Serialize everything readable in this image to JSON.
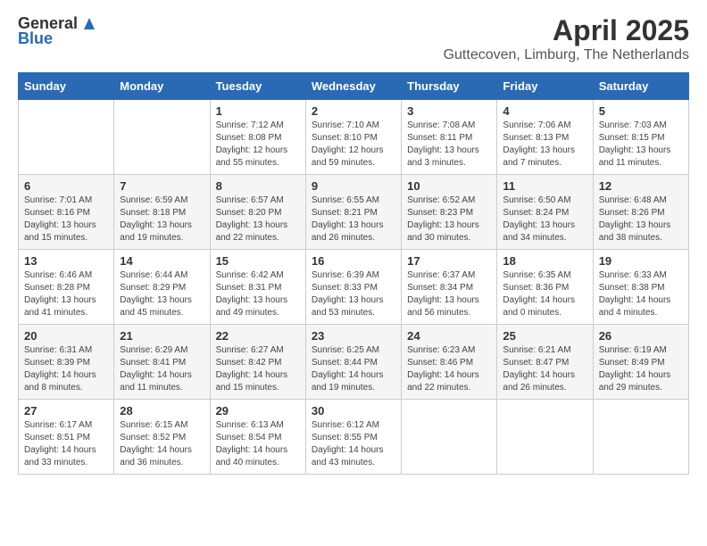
{
  "logo": {
    "text_general": "General",
    "text_blue": "Blue"
  },
  "title": "April 2025",
  "subtitle": "Guttecoven, Limburg, The Netherlands",
  "days_of_week": [
    "Sunday",
    "Monday",
    "Tuesday",
    "Wednesday",
    "Thursday",
    "Friday",
    "Saturday"
  ],
  "weeks": [
    [
      {
        "day": "",
        "sunrise": "",
        "sunset": "",
        "daylight": ""
      },
      {
        "day": "",
        "sunrise": "",
        "sunset": "",
        "daylight": ""
      },
      {
        "day": "1",
        "sunrise": "Sunrise: 7:12 AM",
        "sunset": "Sunset: 8:08 PM",
        "daylight": "Daylight: 12 hours and 55 minutes."
      },
      {
        "day": "2",
        "sunrise": "Sunrise: 7:10 AM",
        "sunset": "Sunset: 8:10 PM",
        "daylight": "Daylight: 12 hours and 59 minutes."
      },
      {
        "day": "3",
        "sunrise": "Sunrise: 7:08 AM",
        "sunset": "Sunset: 8:11 PM",
        "daylight": "Daylight: 13 hours and 3 minutes."
      },
      {
        "day": "4",
        "sunrise": "Sunrise: 7:06 AM",
        "sunset": "Sunset: 8:13 PM",
        "daylight": "Daylight: 13 hours and 7 minutes."
      },
      {
        "day": "5",
        "sunrise": "Sunrise: 7:03 AM",
        "sunset": "Sunset: 8:15 PM",
        "daylight": "Daylight: 13 hours and 11 minutes."
      }
    ],
    [
      {
        "day": "6",
        "sunrise": "Sunrise: 7:01 AM",
        "sunset": "Sunset: 8:16 PM",
        "daylight": "Daylight: 13 hours and 15 minutes."
      },
      {
        "day": "7",
        "sunrise": "Sunrise: 6:59 AM",
        "sunset": "Sunset: 8:18 PM",
        "daylight": "Daylight: 13 hours and 19 minutes."
      },
      {
        "day": "8",
        "sunrise": "Sunrise: 6:57 AM",
        "sunset": "Sunset: 8:20 PM",
        "daylight": "Daylight: 13 hours and 22 minutes."
      },
      {
        "day": "9",
        "sunrise": "Sunrise: 6:55 AM",
        "sunset": "Sunset: 8:21 PM",
        "daylight": "Daylight: 13 hours and 26 minutes."
      },
      {
        "day": "10",
        "sunrise": "Sunrise: 6:52 AM",
        "sunset": "Sunset: 8:23 PM",
        "daylight": "Daylight: 13 hours and 30 minutes."
      },
      {
        "day": "11",
        "sunrise": "Sunrise: 6:50 AM",
        "sunset": "Sunset: 8:24 PM",
        "daylight": "Daylight: 13 hours and 34 minutes."
      },
      {
        "day": "12",
        "sunrise": "Sunrise: 6:48 AM",
        "sunset": "Sunset: 8:26 PM",
        "daylight": "Daylight: 13 hours and 38 minutes."
      }
    ],
    [
      {
        "day": "13",
        "sunrise": "Sunrise: 6:46 AM",
        "sunset": "Sunset: 8:28 PM",
        "daylight": "Daylight: 13 hours and 41 minutes."
      },
      {
        "day": "14",
        "sunrise": "Sunrise: 6:44 AM",
        "sunset": "Sunset: 8:29 PM",
        "daylight": "Daylight: 13 hours and 45 minutes."
      },
      {
        "day": "15",
        "sunrise": "Sunrise: 6:42 AM",
        "sunset": "Sunset: 8:31 PM",
        "daylight": "Daylight: 13 hours and 49 minutes."
      },
      {
        "day": "16",
        "sunrise": "Sunrise: 6:39 AM",
        "sunset": "Sunset: 8:33 PM",
        "daylight": "Daylight: 13 hours and 53 minutes."
      },
      {
        "day": "17",
        "sunrise": "Sunrise: 6:37 AM",
        "sunset": "Sunset: 8:34 PM",
        "daylight": "Daylight: 13 hours and 56 minutes."
      },
      {
        "day": "18",
        "sunrise": "Sunrise: 6:35 AM",
        "sunset": "Sunset: 8:36 PM",
        "daylight": "Daylight: 14 hours and 0 minutes."
      },
      {
        "day": "19",
        "sunrise": "Sunrise: 6:33 AM",
        "sunset": "Sunset: 8:38 PM",
        "daylight": "Daylight: 14 hours and 4 minutes."
      }
    ],
    [
      {
        "day": "20",
        "sunrise": "Sunrise: 6:31 AM",
        "sunset": "Sunset: 8:39 PM",
        "daylight": "Daylight: 14 hours and 8 minutes."
      },
      {
        "day": "21",
        "sunrise": "Sunrise: 6:29 AM",
        "sunset": "Sunset: 8:41 PM",
        "daylight": "Daylight: 14 hours and 11 minutes."
      },
      {
        "day": "22",
        "sunrise": "Sunrise: 6:27 AM",
        "sunset": "Sunset: 8:42 PM",
        "daylight": "Daylight: 14 hours and 15 minutes."
      },
      {
        "day": "23",
        "sunrise": "Sunrise: 6:25 AM",
        "sunset": "Sunset: 8:44 PM",
        "daylight": "Daylight: 14 hours and 19 minutes."
      },
      {
        "day": "24",
        "sunrise": "Sunrise: 6:23 AM",
        "sunset": "Sunset: 8:46 PM",
        "daylight": "Daylight: 14 hours and 22 minutes."
      },
      {
        "day": "25",
        "sunrise": "Sunrise: 6:21 AM",
        "sunset": "Sunset: 8:47 PM",
        "daylight": "Daylight: 14 hours and 26 minutes."
      },
      {
        "day": "26",
        "sunrise": "Sunrise: 6:19 AM",
        "sunset": "Sunset: 8:49 PM",
        "daylight": "Daylight: 14 hours and 29 minutes."
      }
    ],
    [
      {
        "day": "27",
        "sunrise": "Sunrise: 6:17 AM",
        "sunset": "Sunset: 8:51 PM",
        "daylight": "Daylight: 14 hours and 33 minutes."
      },
      {
        "day": "28",
        "sunrise": "Sunrise: 6:15 AM",
        "sunset": "Sunset: 8:52 PM",
        "daylight": "Daylight: 14 hours and 36 minutes."
      },
      {
        "day": "29",
        "sunrise": "Sunrise: 6:13 AM",
        "sunset": "Sunset: 8:54 PM",
        "daylight": "Daylight: 14 hours and 40 minutes."
      },
      {
        "day": "30",
        "sunrise": "Sunrise: 6:12 AM",
        "sunset": "Sunset: 8:55 PM",
        "daylight": "Daylight: 14 hours and 43 minutes."
      },
      {
        "day": "",
        "sunrise": "",
        "sunset": "",
        "daylight": ""
      },
      {
        "day": "",
        "sunrise": "",
        "sunset": "",
        "daylight": ""
      },
      {
        "day": "",
        "sunrise": "",
        "sunset": "",
        "daylight": ""
      }
    ]
  ]
}
